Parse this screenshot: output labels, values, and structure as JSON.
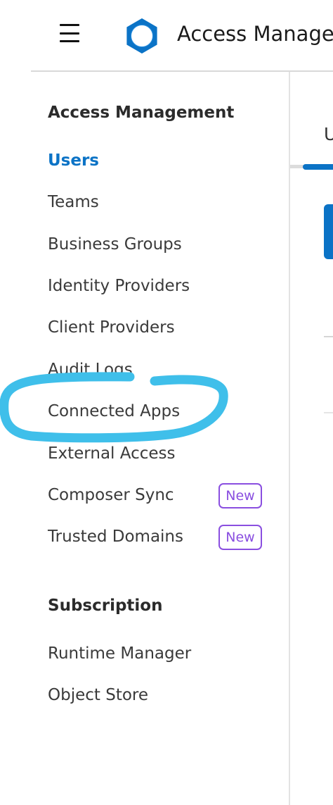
{
  "header": {
    "menu_icon": "hamburger-menu-icon",
    "logo_icon": "anypoint-logo-icon",
    "title": "Access Management",
    "accent_color": "#0b73c6"
  },
  "sidebar": {
    "sections": [
      {
        "title": "Access Management",
        "items": [
          {
            "label": "Users",
            "active": true
          },
          {
            "label": "Teams"
          },
          {
            "label": "Business Groups"
          },
          {
            "label": "Identity Providers"
          },
          {
            "label": "Client Providers"
          },
          {
            "label": "Audit Logs"
          },
          {
            "label": "Connected Apps",
            "highlighted": true
          },
          {
            "label": "External Access"
          },
          {
            "label": "Composer Sync",
            "badge": "New"
          },
          {
            "label": "Trusted Domains",
            "badge": "New"
          }
        ]
      },
      {
        "title": "Subscription",
        "items": [
          {
            "label": "Runtime Manager"
          },
          {
            "label": "Object Store"
          }
        ]
      }
    ],
    "badge_color": "#8a4fe0",
    "highlight_color": "#3fbfea"
  },
  "main": {
    "tab_label": "U"
  }
}
